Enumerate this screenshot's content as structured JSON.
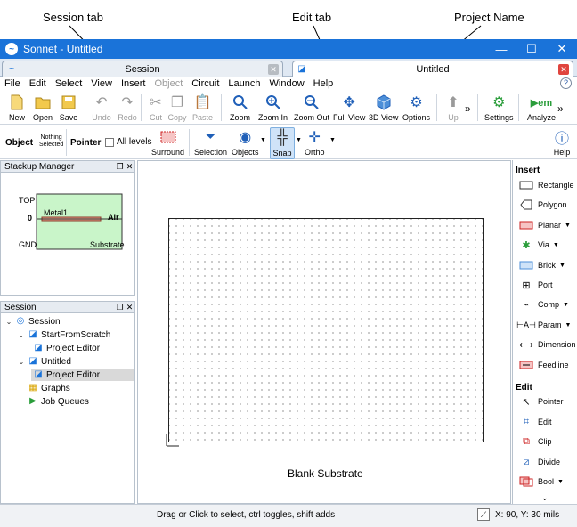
{
  "annotations": {
    "session_tab": "Session tab",
    "edit_tab": "Edit tab",
    "project_name": "Project Name",
    "blank_substrate": "Blank Substrate"
  },
  "window": {
    "title": "Sonnet - Untitled",
    "minimize": "—",
    "maximize": "☐",
    "close": "✕"
  },
  "tabs": {
    "session_label": "Session",
    "edit_label": "Untitled",
    "close_glyph": "✕"
  },
  "menu": [
    "File",
    "Edit",
    "Select",
    "View",
    "Insert",
    "Object",
    "Circuit",
    "Launch",
    "Window",
    "Help"
  ],
  "toolbar": {
    "new": "New",
    "open": "Open",
    "save": "Save",
    "undo": "Undo",
    "redo": "Redo",
    "cut": "Cut",
    "copy": "Copy",
    "paste": "Paste",
    "zoom": "Zoom",
    "zoom_in": "Zoom In",
    "zoom_out": "Zoom Out",
    "full_view": "Full View",
    "view_3d": "3D View",
    "options": "Options",
    "more": "»",
    "up": "Up",
    "settings": "Settings",
    "analyze": "Analyze",
    "more2": "»"
  },
  "toolbar2": {
    "object": "Object",
    "nothing_selected_1": "Nothing",
    "nothing_selected_2": "Selected",
    "pointer": "Pointer",
    "all_levels": "All levels",
    "surround": "Surround",
    "selection": "Selection",
    "objects": "Objects",
    "snap": "Snap",
    "ortho": "Ortho",
    "help": "Help"
  },
  "stackup": {
    "title": "Stackup Manager",
    "top": "TOP",
    "zero": "0",
    "metal": "Metal1",
    "air": "Air",
    "gnd": "GND",
    "substrate": "Substrate"
  },
  "session_panel": {
    "title": "Session",
    "items": [
      {
        "label": "Session"
      },
      {
        "label": "StartFromScratch"
      },
      {
        "label": "Project Editor"
      },
      {
        "label": "Untitled"
      },
      {
        "label": "Project Editor"
      },
      {
        "label": "Graphs"
      },
      {
        "label": "Job Queues"
      }
    ]
  },
  "palette": {
    "insert_head": "Insert",
    "insert": [
      "Rectangle",
      "Polygon",
      "Planar",
      "Via",
      "Brick",
      "Port",
      "Comp",
      "Param",
      "Dimension",
      "Feedline"
    ],
    "edit_head": "Edit",
    "edit": [
      "Pointer",
      "Edit",
      "Clip",
      "Divide",
      "Bool"
    ],
    "more": "⌄"
  },
  "status": {
    "message": "Drag or Click to select, ctrl toggles, shift adds",
    "coords": "X: 90, Y: 30 mils"
  },
  "colors": {
    "titlebar": "#1a73d9",
    "stackup_fill": "#c9f5c9",
    "metal": "#e3a08a"
  }
}
